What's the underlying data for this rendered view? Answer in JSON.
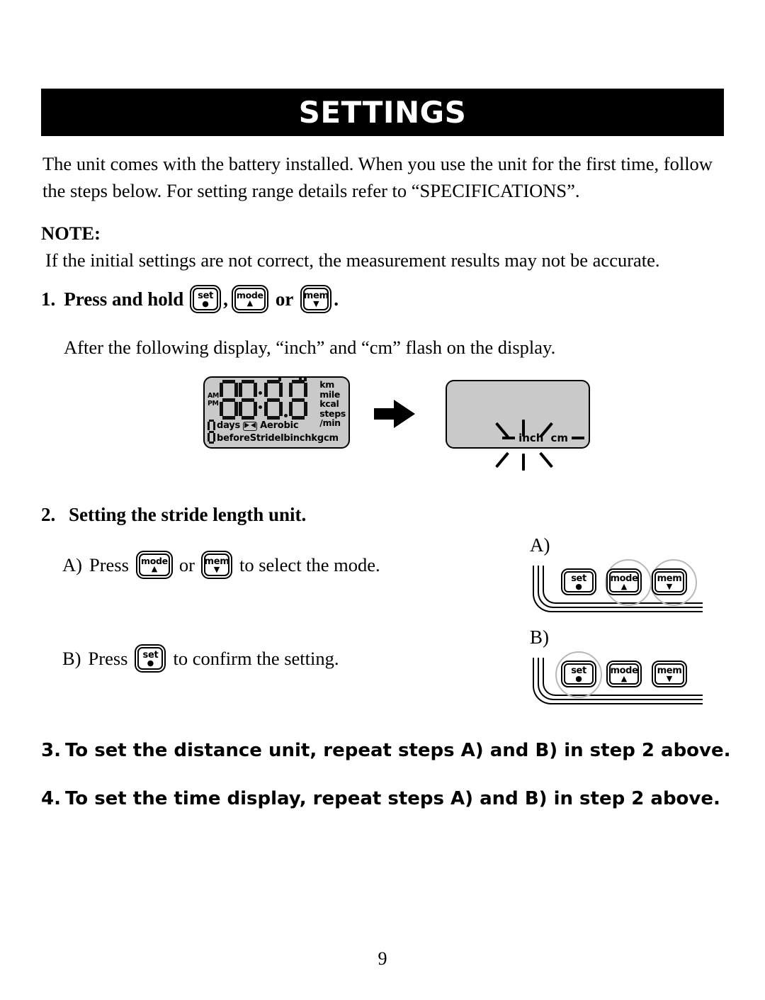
{
  "header": {
    "title": "SETTINGS"
  },
  "intro": {
    "text": "The unit comes with the battery installed. When you use the unit for the first time, follow the steps below. For setting range details refer to “SPECIFICATIONS”."
  },
  "note": {
    "label": "NOTE:",
    "text": "If the initial settings are not correct, the measurement results may not be accurate."
  },
  "step1": {
    "number": "1.",
    "text": "Press and hold",
    "comma": ",",
    "or": "or",
    "period": ".",
    "subtext": "After the following display, “inch” and “cm” flash on the display."
  },
  "buttons": {
    "set": {
      "label": "set",
      "symbol": "●"
    },
    "mode": {
      "label": "mode",
      "symbol": "▲"
    },
    "mem": {
      "label": "mem",
      "symbol": "▼"
    }
  },
  "lcd": {
    "ampm": {
      "am": "AM",
      "pm": "PM"
    },
    "digits": "8888.8",
    "units_right": [
      "km",
      "mile",
      "kcal",
      "steps",
      "/min"
    ],
    "row_mid": {
      "days": "days",
      "icon": "aerobic-icon",
      "aerobic": "Aerobic",
      "per_min": "/min"
    },
    "row_bottom": {
      "before": "before",
      "stride": "Stride",
      "lb": "lb",
      "inch": "inch",
      "kg": "kg",
      "cm": "cm"
    }
  },
  "arrow": {
    "name": "arrow-right-icon"
  },
  "lcd2": {
    "inch": "inch",
    "cm": "cm"
  },
  "step2": {
    "number": "2.",
    "heading": "Setting the stride length unit.",
    "a": {
      "lead": "A)",
      "press": "Press",
      "or": "or",
      "tail": "to select the mode."
    },
    "b": {
      "lead": "B)",
      "press": "Press",
      "tail": "to confirm the setting."
    }
  },
  "diagrams": {
    "a": {
      "label": "A)",
      "highlighted": [
        "mode",
        "mem"
      ]
    },
    "b": {
      "label": "B)",
      "highlighted": [
        "set"
      ]
    }
  },
  "step3": {
    "number": "3.",
    "text": "To set the distance unit, repeat steps A) and B) in step 2 above."
  },
  "step4": {
    "number": "4.",
    "text": "To set the time display, repeat steps A) and B) in step 2 above."
  },
  "footer": {
    "page_number": "9"
  },
  "colors": {
    "banner_bg": "#000000",
    "banner_text": "#ffffff",
    "lcd_bg": "#c9c9c9",
    "highlight_ring": "#b9b9b9"
  }
}
